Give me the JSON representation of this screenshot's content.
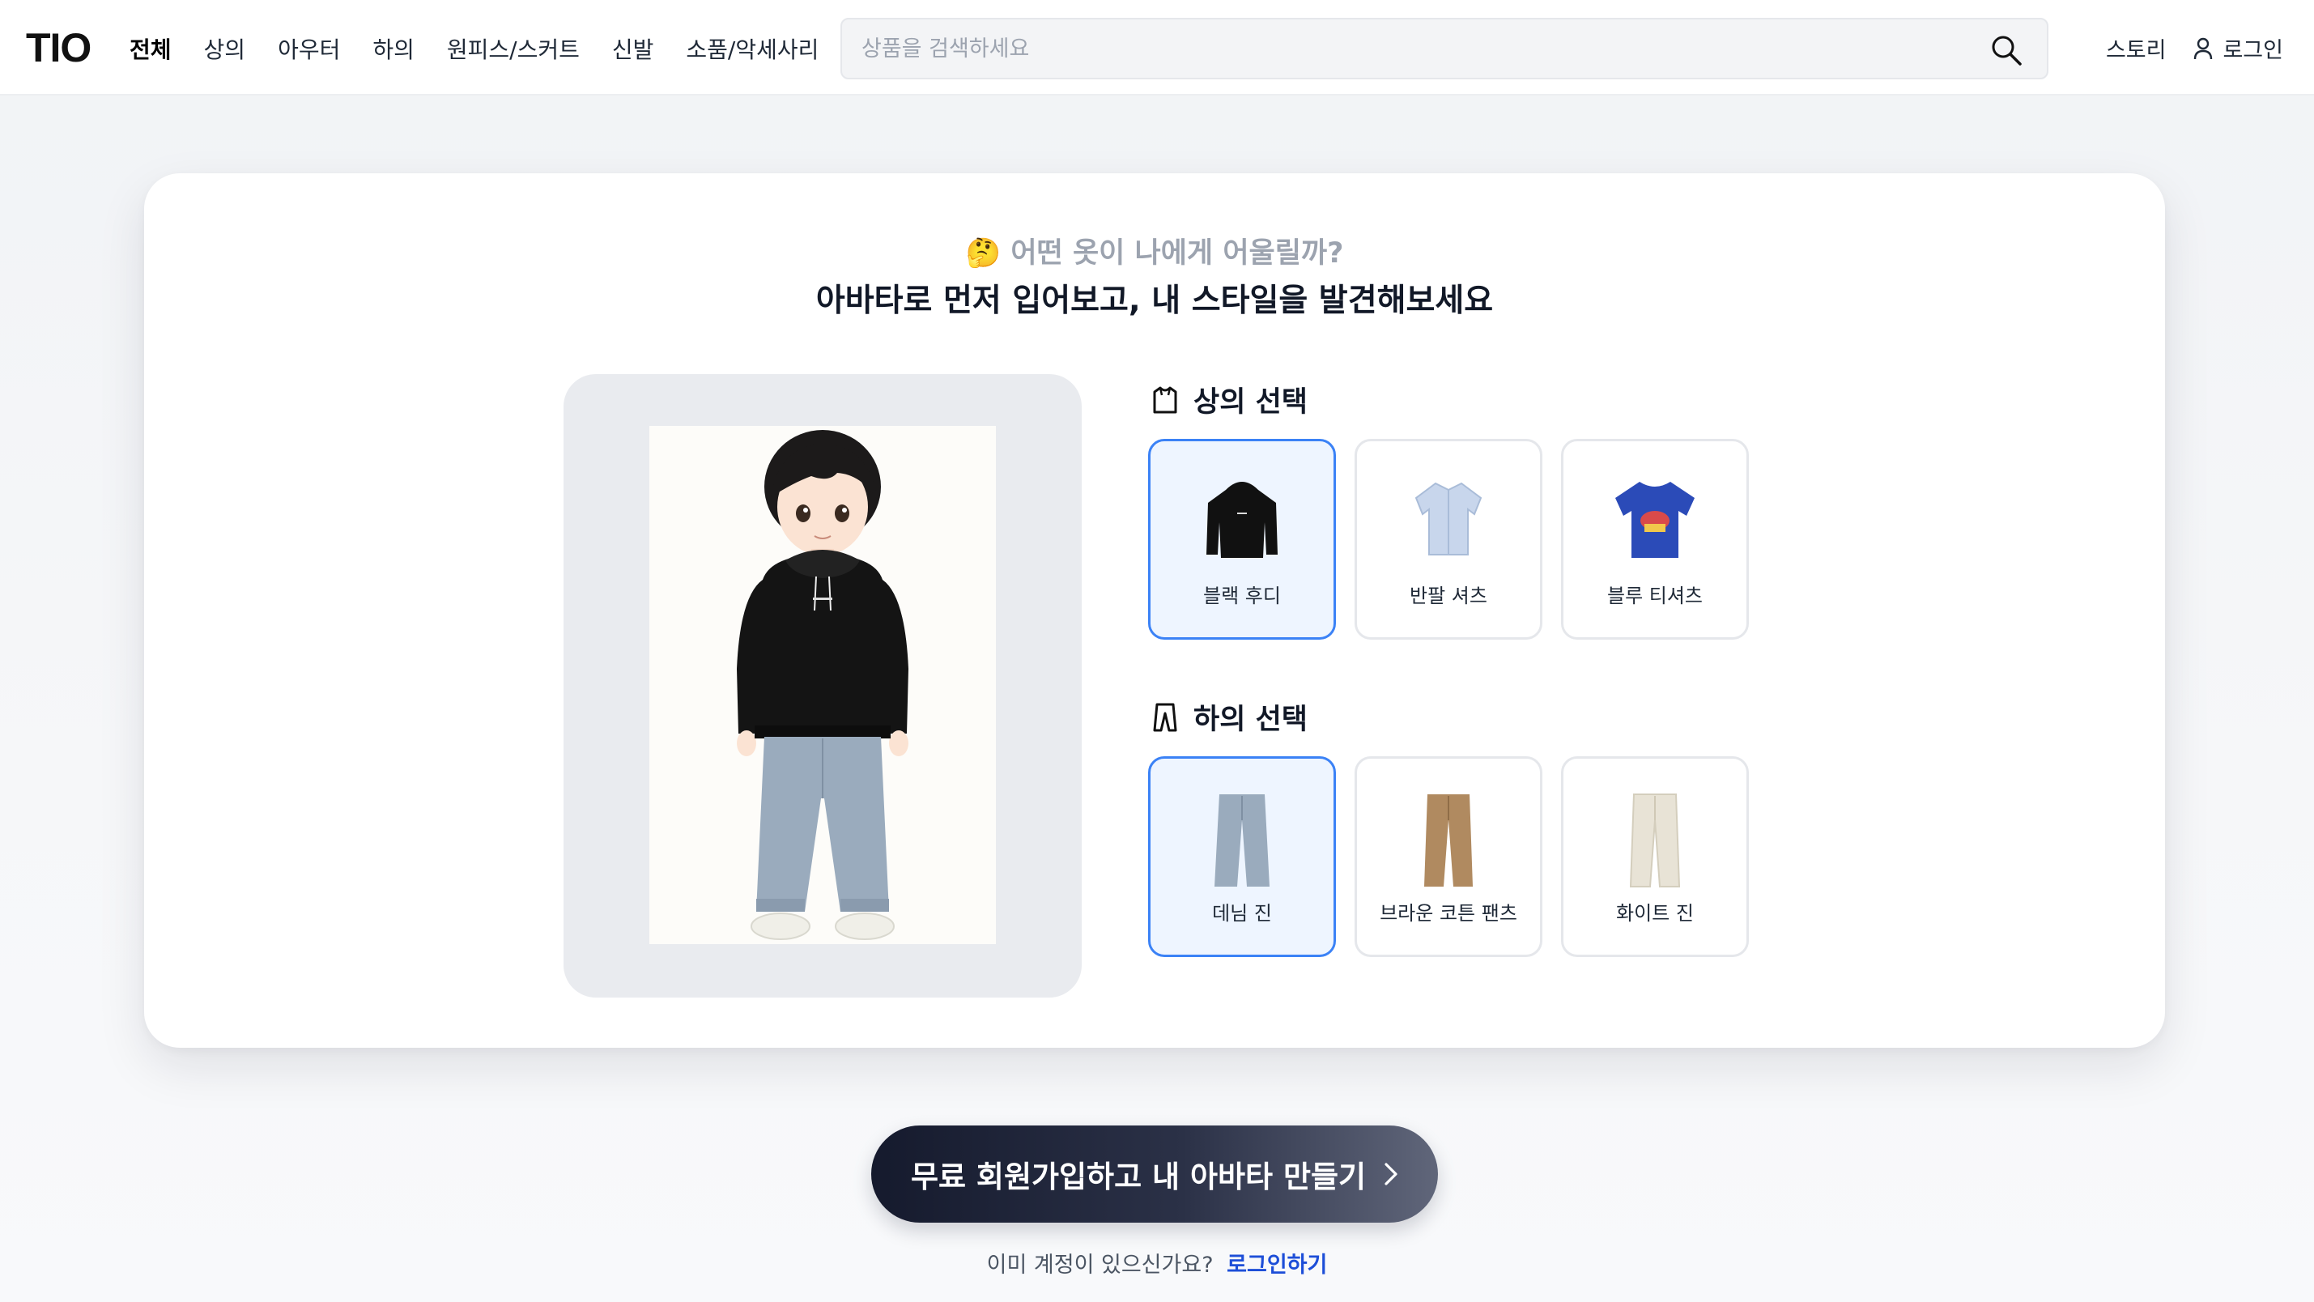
{
  "header": {
    "logo": "TIO",
    "nav": [
      "전체",
      "상의",
      "아우터",
      "하의",
      "원피스/스커트",
      "신발",
      "소품/악세사리"
    ],
    "active_nav": "전체",
    "search_placeholder": "상품을 검색하세요",
    "story_label": "스토리",
    "login_label": "로그인"
  },
  "hero": {
    "emoji": "🤔",
    "question": "어떤 옷이 나에게 어울릴까?",
    "headline": "아바타로 먼저 입어보고, 내 스타일을 발견해보세요"
  },
  "tops": {
    "title": "상의 선택",
    "options": [
      {
        "label": "블랙 후디",
        "color": "#111111",
        "selected": true
      },
      {
        "label": "반팔 셔츠",
        "color": "#c8d6ec",
        "selected": false
      },
      {
        "label": "블루 티셔츠",
        "color": "#2b4bb8",
        "selected": false
      }
    ]
  },
  "bottoms": {
    "title": "하의 선택",
    "options": [
      {
        "label": "데님 진",
        "color": "#9aa9b8",
        "selected": true
      },
      {
        "label": "브라운 코튼 팬츠",
        "color": "#b08a60",
        "selected": false
      },
      {
        "label": "화이트 진",
        "color": "#e8e3d6",
        "selected": false
      }
    ]
  },
  "cta": {
    "label": "무료 회원가입하고 내 아바타 만들기",
    "already_text": "이미 계정이 있으신가요?",
    "login_link": "로그인하기"
  },
  "colors": {
    "accent": "#3b82f6",
    "selected_bg": "#eef5ff",
    "link": "#1d4ed8"
  }
}
